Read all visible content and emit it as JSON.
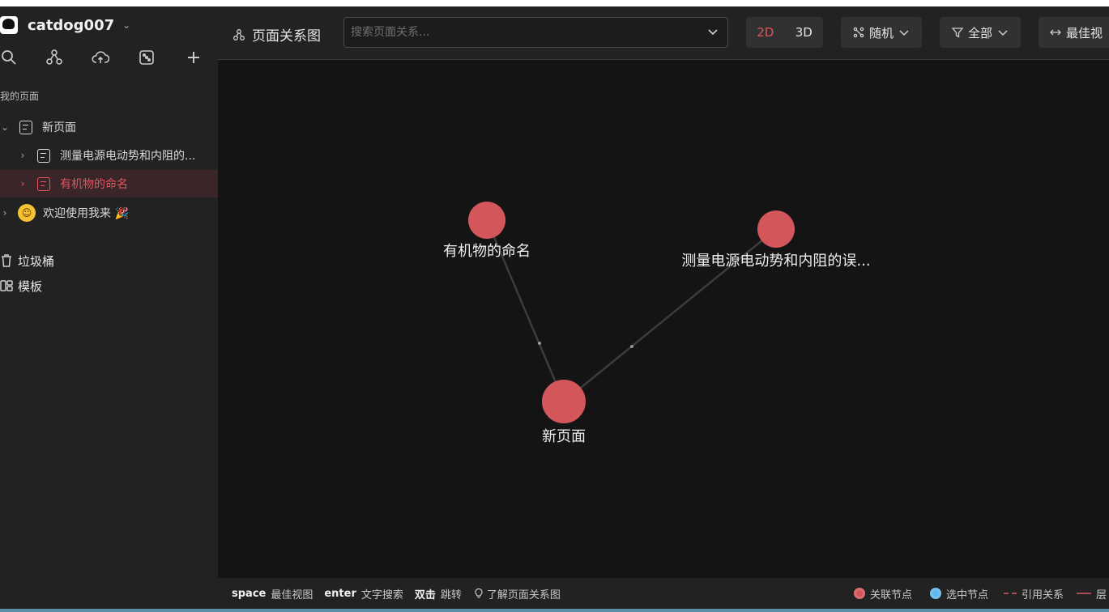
{
  "workspace": {
    "name": "catdog007"
  },
  "sidebar": {
    "section_label": "我的页面",
    "tree": [
      {
        "label": "新页面",
        "expanded": true,
        "level": 0
      },
      {
        "label": "测量电源电动势和内阻的...",
        "expanded": false,
        "level": 1
      },
      {
        "label": "有机物的命名",
        "expanded": false,
        "level": 1,
        "active": true
      },
      {
        "label": "欢迎使用我来 🎉",
        "expanded": false,
        "level": 0,
        "emoji": "smile-emoji"
      }
    ],
    "trash_label": "垃圾桶",
    "templates_label": "模板"
  },
  "topbar": {
    "title": "页面关系图",
    "search_placeholder": "搜索页面关系...",
    "mode_2d": "2D",
    "mode_3d": "3D",
    "active_mode": "2D",
    "layout_label": "随机",
    "filter_label": "全部",
    "fit_label": "最佳视"
  },
  "graph": {
    "nodes": [
      {
        "label": "有机物的命名"
      },
      {
        "label": "测量电源电动势和内阻的误..."
      },
      {
        "label": "新页面"
      }
    ],
    "edges": [
      {
        "from": "新页面",
        "to": "有机物的命名"
      },
      {
        "from": "新页面",
        "to": "测量电源电动势和内阻的误..."
      }
    ],
    "node_color": "#d3565a"
  },
  "bottombar": {
    "hints": [
      {
        "key": "space",
        "text": "最佳视图"
      },
      {
        "key": "enter",
        "text": "文字搜索"
      },
      {
        "key": "双击",
        "text": "跳转"
      }
    ],
    "learn_label": "了解页面关系图",
    "legend": [
      {
        "label": "关联节点",
        "color": "#d3565a"
      },
      {
        "label": "选中节点",
        "color": "#5fb8ec"
      },
      {
        "label": "引用关系",
        "color": "#a64c52"
      },
      {
        "label": "层",
        "color": "#a64c52"
      }
    ]
  }
}
